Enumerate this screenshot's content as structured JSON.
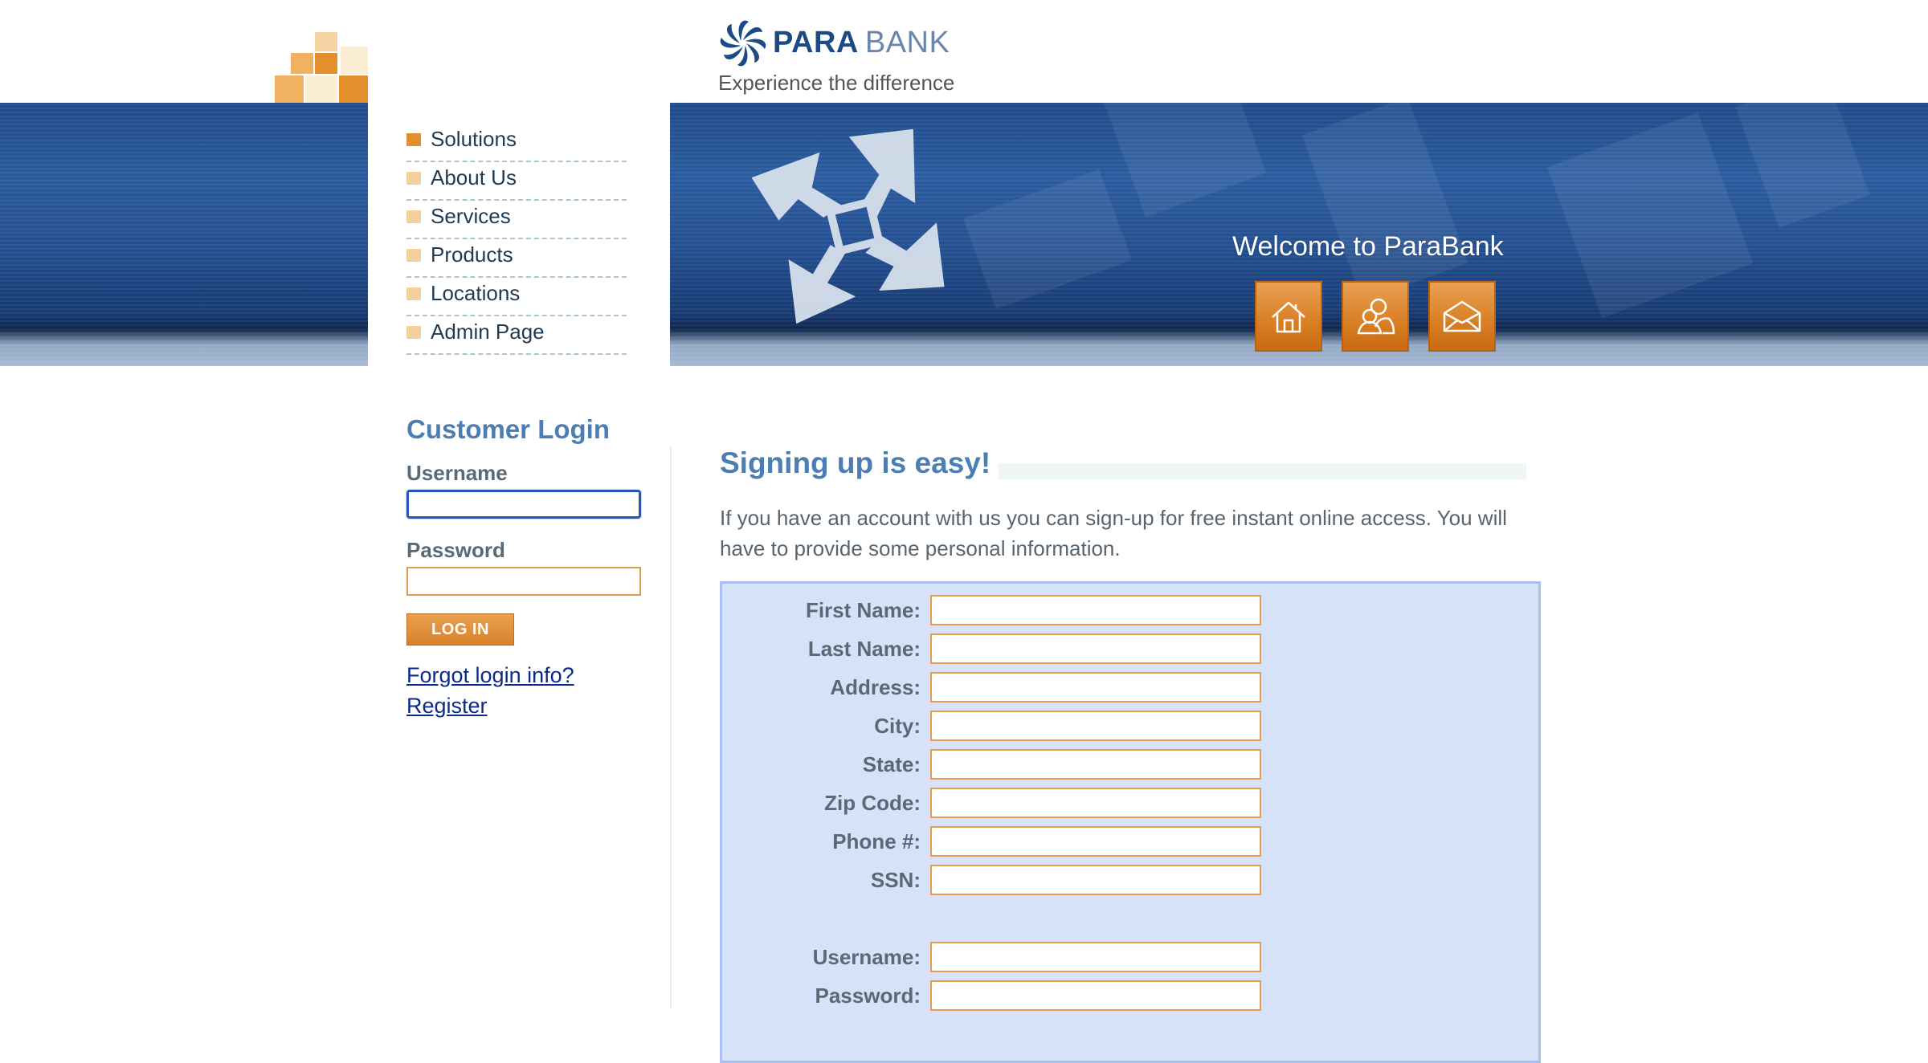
{
  "brand": {
    "logo_bold": "PARA",
    "logo_light": "BANK",
    "tagline": "Experience the difference"
  },
  "nav": {
    "items": [
      {
        "label": "Solutions",
        "active": true
      },
      {
        "label": "About Us"
      },
      {
        "label": "Services"
      },
      {
        "label": "Products"
      },
      {
        "label": "Locations"
      },
      {
        "label": "Admin Page"
      }
    ]
  },
  "banner": {
    "welcome": "Welcome to ParaBank",
    "buttons": [
      "home-icon",
      "contact-icon",
      "mail-icon"
    ]
  },
  "login": {
    "title": "Customer Login",
    "username_label": "Username",
    "username_value": "",
    "password_label": "Password",
    "password_value": "",
    "login_button": "LOG IN",
    "forgot_link": "Forgot login info?",
    "register_link": "Register"
  },
  "signup": {
    "title": "Signing up is easy!",
    "intro": "If you have an account with us you can sign-up for free instant online access. You will have to provide some personal information.",
    "fields": [
      {
        "label": "First Name:",
        "value": ""
      },
      {
        "label": "Last Name:",
        "value": ""
      },
      {
        "label": "Address:",
        "value": ""
      },
      {
        "label": "City:",
        "value": ""
      },
      {
        "label": "State:",
        "value": ""
      },
      {
        "label": "Zip Code:",
        "value": ""
      },
      {
        "label": "Phone #:",
        "value": ""
      },
      {
        "label": "SSN:",
        "value": ""
      },
      {
        "label": "Username:",
        "value": ""
      },
      {
        "label": "Password:",
        "value": ""
      }
    ]
  },
  "colors": {
    "accent_orange": "#e0902e",
    "title_blue": "#4c7db3",
    "form_bg": "#d6e2fa",
    "input_border": "#e59a4c",
    "link": "#0c2b88"
  }
}
